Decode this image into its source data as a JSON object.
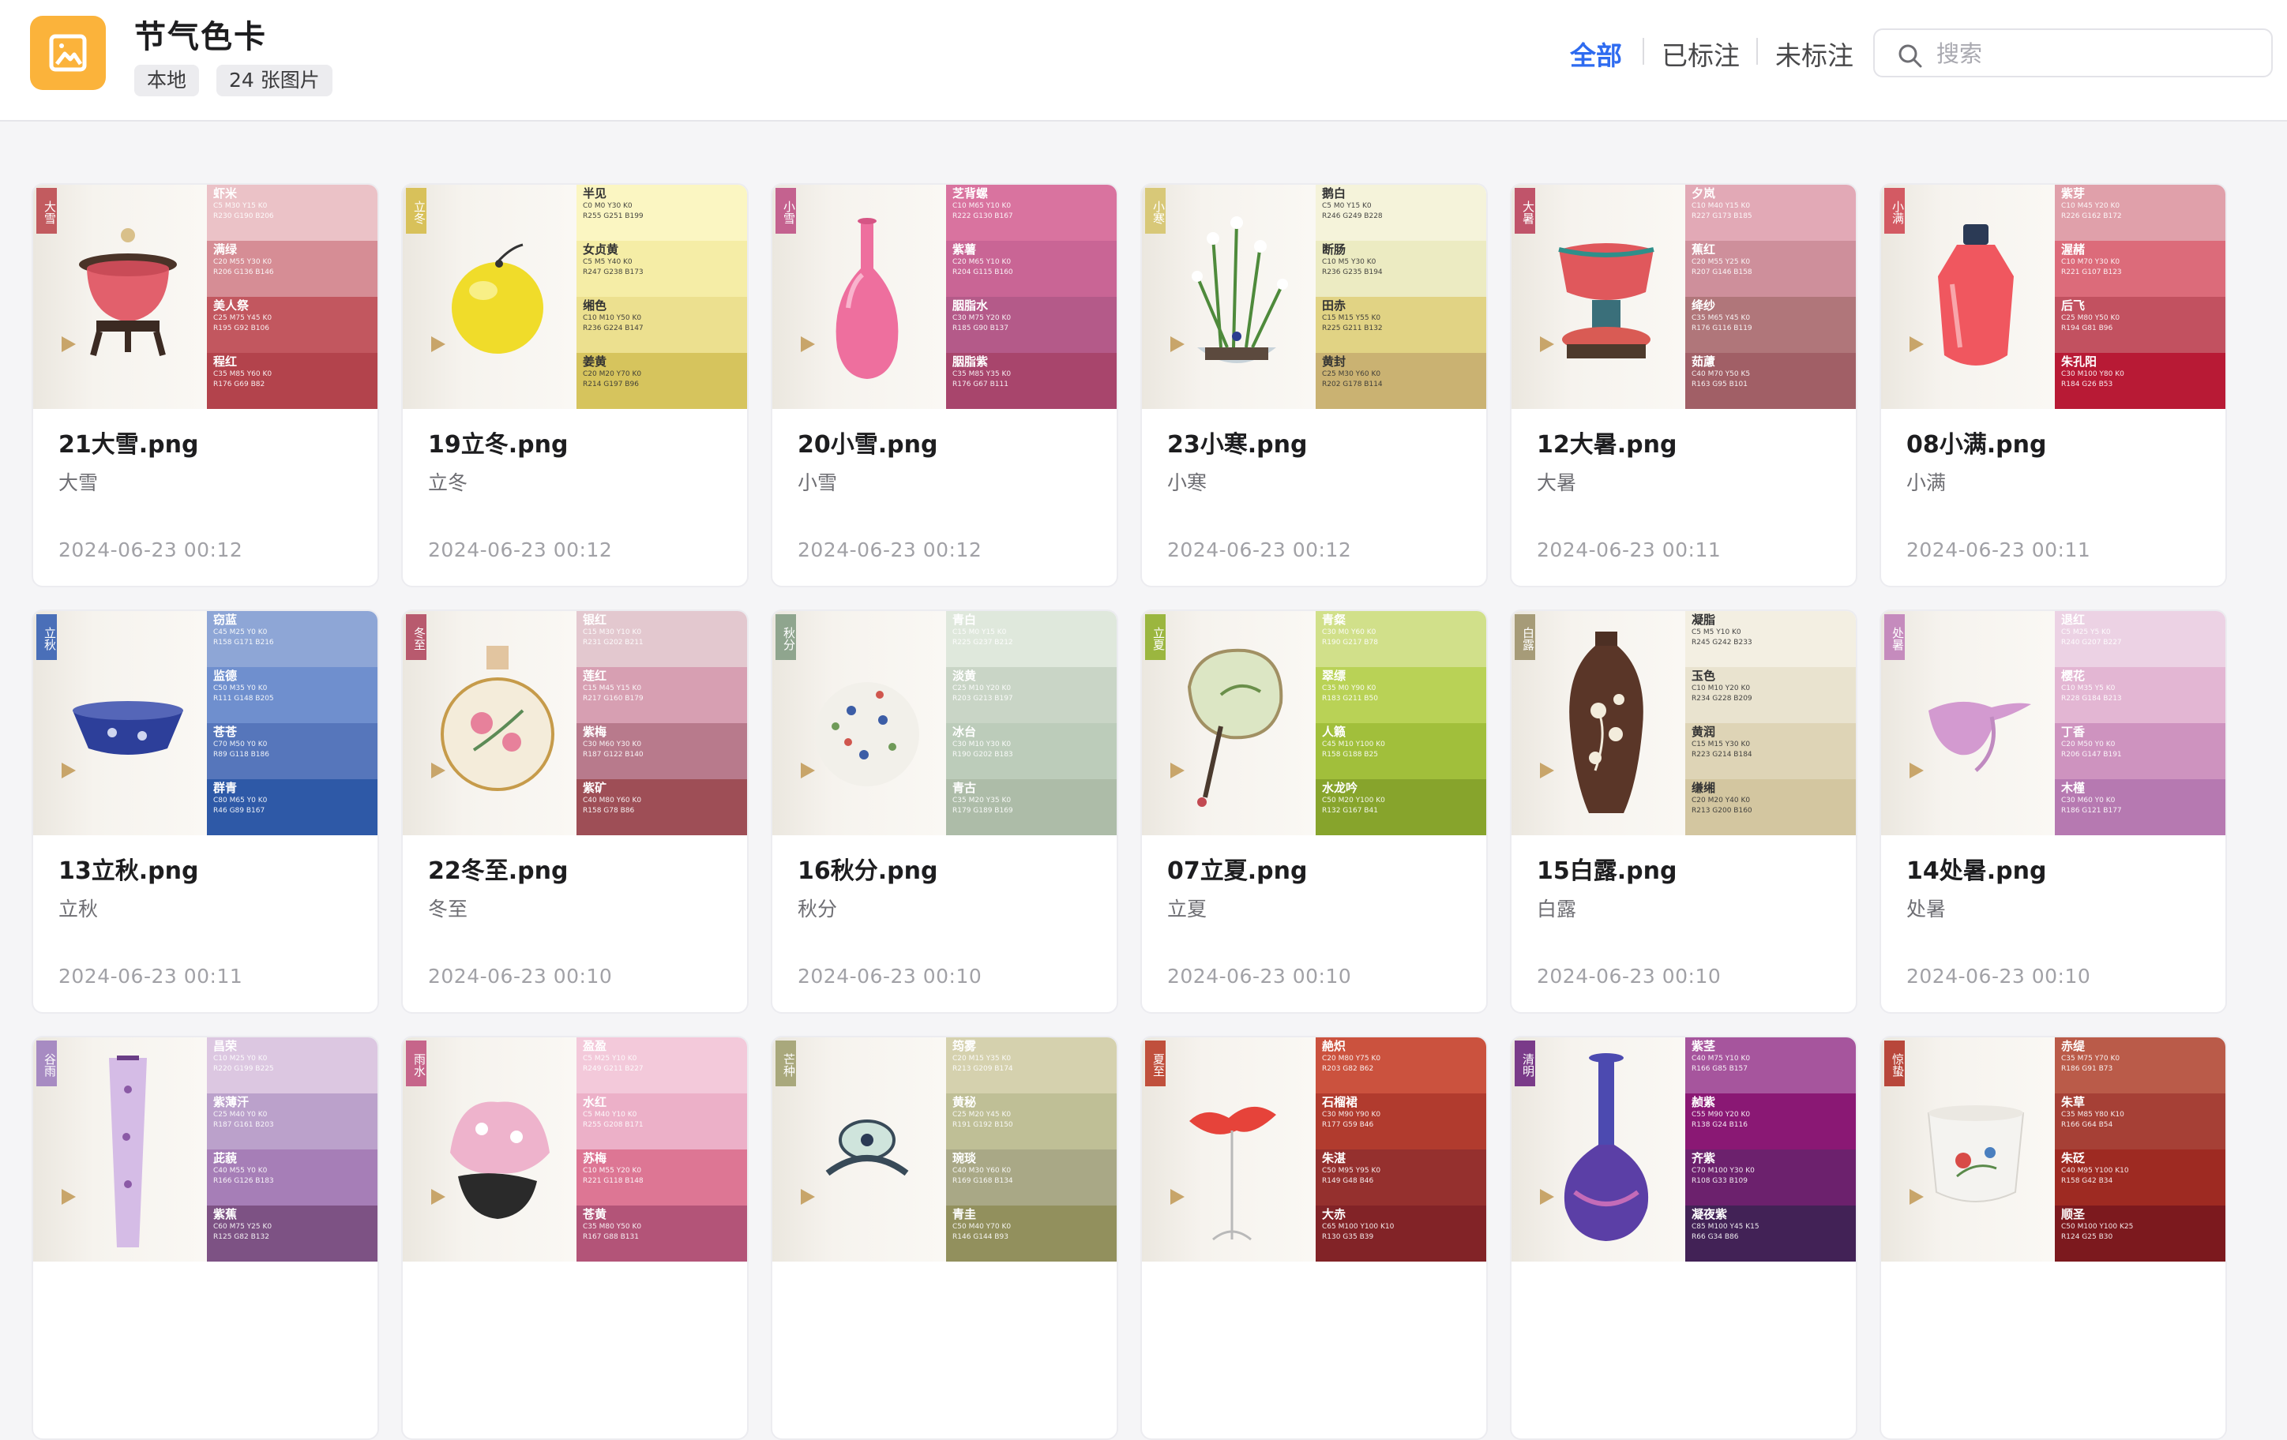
{
  "header": {
    "title": "节气色卡",
    "badges": [
      "本地",
      "24 张图片"
    ],
    "filters": [
      "全部",
      "已标注",
      "未标注"
    ],
    "active_filter": "全部",
    "search_placeholder": "搜索",
    "app_icon": "image-icon",
    "search_icon": "search-icon",
    "accent_color": "#2e6bf0"
  },
  "cards": [
    {
      "file": "21大雪.png",
      "label": "大雪",
      "date": "2024-06-23 00:12",
      "tag": "大雪",
      "tag_color": "#c25b5f",
      "object": "censer",
      "swatches": [
        {
          "name": "虾米",
          "code": "C5 M30 Y15 K0\nR230 G190 B206",
          "color": "#ebc2c7",
          "text": "#ffffff"
        },
        {
          "name": "满绿",
          "code": "C20 M55 Y30 K0\nR206 G136 B146",
          "color": "#d68d95",
          "text": "#ffffff"
        },
        {
          "name": "美人祭",
          "code": "C25 M75 Y45 K0\nR195 G92 B106",
          "color": "#c2575f",
          "text": "#ffffff"
        },
        {
          "name": "程红",
          "code": "C35 M85 Y60 K0\nR176 G69 B82",
          "color": "#b3434c",
          "text": "#ffffff"
        }
      ]
    },
    {
      "file": "19立冬.png",
      "label": "立冬",
      "date": "2024-06-23 00:12",
      "tag": "立冬",
      "tag_color": "#d8c15a",
      "object": "orb",
      "swatches": [
        {
          "name": "半见",
          "code": "C0 M0 Y30 K0\nR255 G251 B199",
          "color": "#fbf6c2",
          "text": "#333333"
        },
        {
          "name": "女贞黄",
          "code": "C5 M5 Y40 K0\nR247 G238 B173",
          "color": "#f5eda6",
          "text": "#333333"
        },
        {
          "name": "缃色",
          "code": "C10 M10 Y50 K0\nR236 G224 B147",
          "color": "#ece08f",
          "text": "#333333"
        },
        {
          "name": "姜黄",
          "code": "C20 M20 Y70 K0\nR214 G197 B96",
          "color": "#d6c45d",
          "text": "#333333"
        }
      ]
    },
    {
      "file": "20小雪.png",
      "label": "小雪",
      "date": "2024-06-23 00:12",
      "tag": "小雪",
      "tag_color": "#c4628f",
      "object": "vase",
      "swatches": [
        {
          "name": "芝背螺",
          "code": "C10 M65 Y10 K0\nR222 G130 B167",
          "color": "#d9739f",
          "text": "#ffffff"
        },
        {
          "name": "紫薯",
          "code": "C20 M65 Y10 K0\nR204 G115 B160",
          "color": "#c96595",
          "text": "#ffffff"
        },
        {
          "name": "胭脂水",
          "code": "C30 M75 Y20 K0\nR185 G90 B137",
          "color": "#b45a89",
          "text": "#ffffff"
        },
        {
          "name": "胭脂紫",
          "code": "C35 M85 Y35 K0\nR176 G67 B111",
          "color": "#a8456c",
          "text": "#ffffff"
        }
      ]
    },
    {
      "file": "23小寒.png",
      "label": "小寒",
      "date": "2024-06-23 00:12",
      "tag": "小寒",
      "tag_color": "#d8c878",
      "object": "narcissus",
      "swatches": [
        {
          "name": "鹅白",
          "code": "C5 M0 Y15 K0\nR246 G249 B228",
          "color": "#f5f3da",
          "text": "#333333"
        },
        {
          "name": "断肠",
          "code": "C10 M5 Y30 K0\nR236 G235 B194",
          "color": "#ecebc2",
          "text": "#333333"
        },
        {
          "name": "田赤",
          "code": "C15 M15 Y55 K0\nR225 G211 B132",
          "color": "#e1d384",
          "text": "#333333"
        },
        {
          "name": "黄封",
          "code": "C25 M30 Y60 K0\nR202 G178 B114",
          "color": "#cab272",
          "text": "#333333"
        }
      ]
    },
    {
      "file": "12大暑.png",
      "label": "大暑",
      "date": "2024-06-23 00:11",
      "tag": "大暑",
      "tag_color": "#c0546a",
      "object": "lotus-stand",
      "swatches": [
        {
          "name": "夕岚",
          "code": "C10 M40 Y15 K0\nR227 G173 B185",
          "color": "#e2a9b6",
          "text": "#ffffff"
        },
        {
          "name": "蕉红",
          "code": "C20 M55 Y25 K0\nR207 G146 B158",
          "color": "#ce8f9b",
          "text": "#ffffff"
        },
        {
          "name": "绛纱",
          "code": "C35 M65 Y45 K0\nR176 G116 B119",
          "color": "#b0767a",
          "text": "#ffffff"
        },
        {
          "name": "茹藘",
          "code": "C40 M70 Y50 K5\nR163 G95 B101",
          "color": "#a15f66",
          "text": "#ffffff"
        }
      ]
    },
    {
      "file": "08小满.png",
      "label": "小满",
      "date": "2024-06-23 00:11",
      "tag": "小满",
      "tag_color": "#d35a63",
      "object": "snuff-bottle",
      "swatches": [
        {
          "name": "紫芽",
          "code": "C10 M45 Y20 K0\nR226 G162 B172",
          "color": "#e0a0aa",
          "text": "#ffffff"
        },
        {
          "name": "渥赭",
          "code": "C10 M70 Y30 K0\nR221 G107 B123",
          "color": "#dc6b7a",
          "text": "#ffffff"
        },
        {
          "name": "后飞",
          "code": "C25 M80 Y50 K0\nR194 G81 B96",
          "color": "#c25160",
          "text": "#ffffff"
        },
        {
          "name": "朱孔阳",
          "code": "C30 M100 Y80 K0\nR184 G26 B53",
          "color": "#b81a35",
          "text": "#ffffff"
        }
      ]
    },
    {
      "file": "13立秋.png",
      "label": "立秋",
      "date": "2024-06-23 00:11",
      "tag": "立秋",
      "tag_color": "#4a6fb8",
      "object": "basin",
      "swatches": [
        {
          "name": "窃蓝",
          "code": "C45 M25 Y0 K0\nR158 G171 B216",
          "color": "#8ea6d6",
          "text": "#ffffff"
        },
        {
          "name": "监德",
          "code": "C50 M35 Y0 K0\nR111 G148 B205",
          "color": "#6f8fce",
          "text": "#ffffff"
        },
        {
          "name": "苍苍",
          "code": "C70 M50 Y0 K0\nR89 G118 B186",
          "color": "#5676bb",
          "text": "#ffffff"
        },
        {
          "name": "群青",
          "code": "C80 M65 Y0 K0\nR46 G89 B167",
          "color": "#2e59a7",
          "text": "#ffffff"
        }
      ]
    },
    {
      "file": "22冬至.png",
      "label": "冬至",
      "date": "2024-06-23 00:10",
      "tag": "冬至",
      "tag_color": "#b85a6e",
      "object": "moon-flask",
      "swatches": [
        {
          "name": "银红",
          "code": "C15 M30 Y10 K0\nR231 G202 B211",
          "color": "#e3c8cf",
          "text": "#ffffff"
        },
        {
          "name": "莲红",
          "code": "C15 M45 Y15 K0\nR217 G160 B179",
          "color": "#d79fb2",
          "text": "#ffffff"
        },
        {
          "name": "紫梅",
          "code": "C30 M60 Y30 K0\nR187 G122 B140",
          "color": "#b87a8c",
          "text": "#ffffff"
        },
        {
          "name": "紫矿",
          "code": "C40 M80 Y60 K0\nR158 G78 B86",
          "color": "#9e4e56",
          "text": "#ffffff"
        }
      ]
    },
    {
      "file": "16秋分.png",
      "label": "秋分",
      "date": "2024-06-23 00:10",
      "tag": "秋分",
      "tag_color": "#8fa58e",
      "object": "flask",
      "swatches": [
        {
          "name": "青白",
          "code": "C15 M0 Y15 K0\nR225 G237 B212",
          "color": "#dfe8dc",
          "text": "#ffffff"
        },
        {
          "name": "淡黄",
          "code": "C25 M10 Y20 K0\nR203 G213 B197",
          "color": "#c9d5c6",
          "text": "#ffffff"
        },
        {
          "name": "冰台",
          "code": "C30 M10 Y30 K0\nR190 G202 B183",
          "color": "#bcccba",
          "text": "#ffffff"
        },
        {
          "name": "青古",
          "code": "C35 M20 Y35 K0\nR179 G189 B169",
          "color": "#adbca8",
          "text": "#ffffff"
        }
      ]
    },
    {
      "file": "07立夏.png",
      "label": "立夏",
      "date": "2024-06-23 00:10",
      "tag": "立夏",
      "tag_color": "#9bb63f",
      "object": "fan",
      "swatches": [
        {
          "name": "青粲",
          "code": "C30 M0 Y60 K0\nR190 G217 B78",
          "color": "#d1e08a",
          "text": "#ffffff"
        },
        {
          "name": "翠缥",
          "code": "C35 M0 Y90 K0\nR183 G211 B50",
          "color": "#b9d256",
          "text": "#ffffff"
        },
        {
          "name": "人籁",
          "code": "C45 M10 Y100 K0\nR158 G188 B25",
          "color": "#a1bf3b",
          "text": "#ffffff"
        },
        {
          "name": "水龙吟",
          "code": "C50 M20 Y100 K0\nR132 G167 B41",
          "color": "#87a42c",
          "text": "#ffffff"
        }
      ]
    },
    {
      "file": "15白露.png",
      "label": "白露",
      "date": "2024-06-23 00:10",
      "tag": "白露",
      "tag_color": "#a69b78",
      "object": "dark-vase",
      "swatches": [
        {
          "name": "凝脂",
          "code": "C5 M5 Y10 K0\nR245 G242 B233",
          "color": "#f3efe2",
          "text": "#333333"
        },
        {
          "name": "玉色",
          "code": "C10 M10 Y20 K0\nR234 G228 B209",
          "color": "#e9e3cf",
          "text": "#333333"
        },
        {
          "name": "黄润",
          "code": "C15 M15 Y30 K0\nR223 G214 B184",
          "color": "#ded4b6",
          "text": "#333333"
        },
        {
          "name": "缣缃",
          "code": "C20 M20 Y40 K0\nR213 G200 B160",
          "color": "#d3c6a0",
          "text": "#333333"
        }
      ]
    },
    {
      "file": "14处暑.png",
      "label": "处暑",
      "date": "2024-06-23 00:10",
      "tag": "处暑",
      "tag_color": "#c58bbd",
      "object": "cup",
      "swatches": [
        {
          "name": "退红",
          "code": "C5 M25 Y5 K0\nR240 G207 B227",
          "color": "#ecd2e4",
          "text": "#ffffff"
        },
        {
          "name": "樱花",
          "code": "C10 M35 Y5 K0\nR228 G184 B213",
          "color": "#e3b6d3",
          "text": "#ffffff"
        },
        {
          "name": "丁香",
          "code": "C20 M50 Y0 K0\nR206 G147 B191",
          "color": "#ce93bf",
          "text": "#ffffff"
        },
        {
          "name": "木槿",
          "code": "C30 M60 Y0 K0\nR186 G121 B177",
          "color": "#b679b1",
          "text": "#ffffff"
        }
      ]
    },
    {
      "file": "",
      "label": "",
      "date": "",
      "tag": "谷雨",
      "tag_color": "#a78bc2",
      "object": "scroll",
      "swatches": [
        {
          "name": "昌荣",
          "code": "C10 M25 Y0 K0\nR220 G199 B225",
          "color": "#dcc7e1",
          "text": "#ffffff"
        },
        {
          "name": "紫薄汗",
          "code": "C25 M40 Y0 K0\nR187 G161 B203",
          "color": "#bba1cb",
          "text": "#ffffff"
        },
        {
          "name": "茈藐",
          "code": "C40 M55 Y0 K0\nR166 G126 B183",
          "color": "#a67eb7",
          "text": "#ffffff"
        },
        {
          "name": "紫蕉",
          "code": "C60 M75 Y25 K0\nR125 G82 B132",
          "color": "#7d5284",
          "text": "#ffffff"
        }
      ]
    },
    {
      "file": "",
      "label": "",
      "date": "",
      "tag": "雨水",
      "tag_color": "#c6658a",
      "object": "flower-stone",
      "swatches": [
        {
          "name": "盈盈",
          "code": "C5 M25 Y10 K0\nR249 G211 B227",
          "color": "#f3c9da",
          "text": "#ffffff"
        },
        {
          "name": "水红",
          "code": "C5 M40 Y10 K0\nR255 G208 B171",
          "color": "#ecb0c8",
          "text": "#ffffff"
        },
        {
          "name": "苏梅",
          "code": "C10 M55 Y20 K0\nR221 G118 B148",
          "color": "#dd7694",
          "text": "#ffffff"
        },
        {
          "name": "苍黄",
          "code": "C35 M80 Y50 K0\nR167 G88 B131",
          "color": "#b35478",
          "text": "#ffffff"
        }
      ]
    },
    {
      "file": "",
      "label": "",
      "date": "",
      "tag": "芒种",
      "tag_color": "#a9a87c",
      "object": "mirror",
      "swatches": [
        {
          "name": "筠雾",
          "code": "C20 M15 Y35 K0\nR213 G209 B174",
          "color": "#d5d1ae",
          "text": "#ffffff"
        },
        {
          "name": "黄秘",
          "code": "C25 M20 Y45 K0\nR191 G192 B150",
          "color": "#bfbf96",
          "text": "#ffffff"
        },
        {
          "name": "琬琰",
          "code": "C40 M30 Y60 K0\nR169 G168 B134",
          "color": "#a9a886",
          "text": "#ffffff"
        },
        {
          "name": "青圭",
          "code": "C50 M40 Y70 K0\nR146 G144 B93",
          "color": "#92905d",
          "text": "#ffffff"
        }
      ]
    },
    {
      "file": "",
      "label": "",
      "date": "",
      "tag": "夏至",
      "tag_color": "#c0503c",
      "object": "feather",
      "swatches": [
        {
          "name": "赩炽",
          "code": "C20 M80 Y75 K0\nR203 G82 B62",
          "color": "#cb523e",
          "text": "#ffffff"
        },
        {
          "name": "石榴裙",
          "code": "C30 M90 Y90 K0\nR177 G59 B46",
          "color": "#b13b2e",
          "text": "#ffffff"
        },
        {
          "name": "朱湛",
          "code": "C50 M95 Y95 K0\nR149 G48 B46",
          "color": "#95302e",
          "text": "#ffffff"
        },
        {
          "name": "大赤",
          "code": "C65 M100 Y100 K10\nR130 G35 B39",
          "color": "#822327",
          "text": "#ffffff"
        }
      ]
    },
    {
      "file": "",
      "label": "",
      "date": "",
      "tag": "清明",
      "tag_color": "#7a3b89",
      "object": "purple-vase",
      "swatches": [
        {
          "name": "紫茎",
          "code": "C40 M75 Y10 K0\nR166 G85 B157",
          "color": "#a6559d",
          "text": "#ffffff"
        },
        {
          "name": "赪紫",
          "code": "C55 M90 Y20 K0\nR138 G24 B116",
          "color": "#8a1874",
          "text": "#ffffff"
        },
        {
          "name": "齐紫",
          "code": "C70 M100 Y30 K0\nR108 G33 B109",
          "color": "#6c216d",
          "text": "#ffffff"
        },
        {
          "name": "凝夜紫",
          "code": "C85 M100 Y45 K15\nR66 G34 B86",
          "color": "#422256",
          "text": "#ffffff"
        }
      ]
    },
    {
      "file": "",
      "label": "",
      "date": "",
      "tag": "惊蛰",
      "tag_color": "#b8473b",
      "object": "bowl",
      "swatches": [
        {
          "name": "赤缇",
          "code": "C35 M75 Y70 K0\nR186 G91 B73",
          "color": "#ba5b49",
          "text": "#ffffff"
        },
        {
          "name": "朱草",
          "code": "C35 M85 Y80 K10\nR166 G64 B54",
          "color": "#a64036",
          "text": "#ffffff"
        },
        {
          "name": "朱砭",
          "code": "C40 M95 Y100 K10\nR158 G42 B34",
          "color": "#9e2a22",
          "text": "#ffffff"
        },
        {
          "name": "顺圣",
          "code": "C50 M100 Y100 K25\nR124 G25 B30",
          "color": "#7c191e",
          "text": "#ffffff"
        }
      ]
    }
  ]
}
